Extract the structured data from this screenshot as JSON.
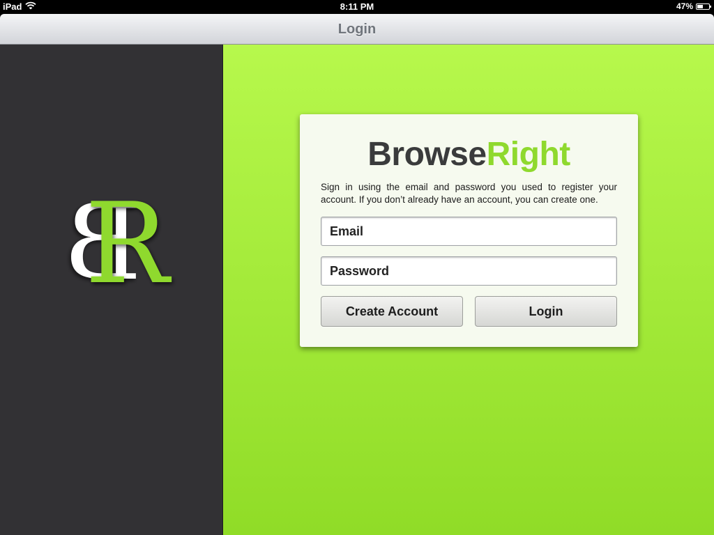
{
  "status": {
    "device": "iPad",
    "time": "8:11 PM",
    "battery": "47%",
    "battery_level": 0.47
  },
  "nav": {
    "title": "Login"
  },
  "logo": {
    "letters": "BR"
  },
  "card": {
    "brand_part1": "Browse",
    "brand_part2": "Right",
    "info": "Sign in using the email and password you used to register your account. If you don’t already have an account, you can create one.",
    "email_placeholder": "Email",
    "password_placeholder": "Password",
    "create_label": "Create Account",
    "login_label": "Login"
  },
  "colors": {
    "accent_green": "#8fd92e",
    "panel_dark": "#323134",
    "background_green": "#b7f84c"
  }
}
